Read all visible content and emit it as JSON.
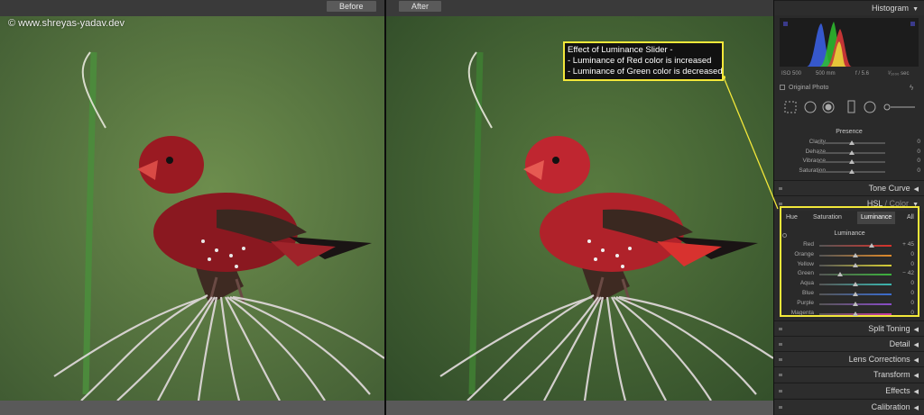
{
  "labels": {
    "before": "Before",
    "after": "After"
  },
  "watermark": "© www.shreyas-yadav.dev",
  "annotation": {
    "lines": [
      "Effect of Luminance Slider -",
      "- Luminance of Red color is increased",
      "- Luminance of Green color is decreased"
    ]
  },
  "panel": {
    "histogram": {
      "title": "Histogram",
      "iso": "ISO 500",
      "focal": "500 mm",
      "aperture": "f / 5.6",
      "shutter": "¹⁄₁₀₀₀ sec",
      "original_photo": "Original Photo"
    },
    "presence": {
      "title": "Presence",
      "sliders": [
        {
          "label": "Clarity",
          "value": "0",
          "pos": 0.5
        },
        {
          "label": "Dehaze",
          "value": "0",
          "pos": 0.5
        },
        {
          "label": "Vibrance",
          "value": "0",
          "pos": 0.5
        },
        {
          "label": "Saturation",
          "value": "0",
          "pos": 0.5
        }
      ]
    },
    "sections": {
      "tone_curve": "Tone Curve",
      "hsl_a": "HSL",
      "hsl_sep": " / ",
      "hsl_b": "Color",
      "split_toning": "Split Toning",
      "detail": "Detail",
      "lens": "Lens Corrections",
      "transform": "Transform",
      "effects": "Effects",
      "calibration": "Calibration"
    },
    "hsl": {
      "tabs": [
        "Hue",
        "Saturation",
        "Luminance",
        "All"
      ],
      "active_tab": "Luminance",
      "title": "Luminance",
      "sliders": [
        {
          "label": "Red",
          "value": "+ 45",
          "pos": 0.725,
          "color": "#d9322b"
        },
        {
          "label": "Orange",
          "value": "0",
          "pos": 0.5,
          "color": "#e08a2a"
        },
        {
          "label": "Yellow",
          "value": "0",
          "pos": 0.5,
          "color": "#d8cf35"
        },
        {
          "label": "Green",
          "value": "− 42",
          "pos": 0.29,
          "color": "#3cb43c"
        },
        {
          "label": "Aqua",
          "value": "0",
          "pos": 0.5,
          "color": "#3ab8b0"
        },
        {
          "label": "Blue",
          "value": "0",
          "pos": 0.5,
          "color": "#3a6cd0"
        },
        {
          "label": "Purple",
          "value": "0",
          "pos": 0.5,
          "color": "#8a4cc8"
        },
        {
          "label": "Magenta",
          "value": "0",
          "pos": 0.5,
          "color": "#c83aa8"
        }
      ]
    }
  }
}
